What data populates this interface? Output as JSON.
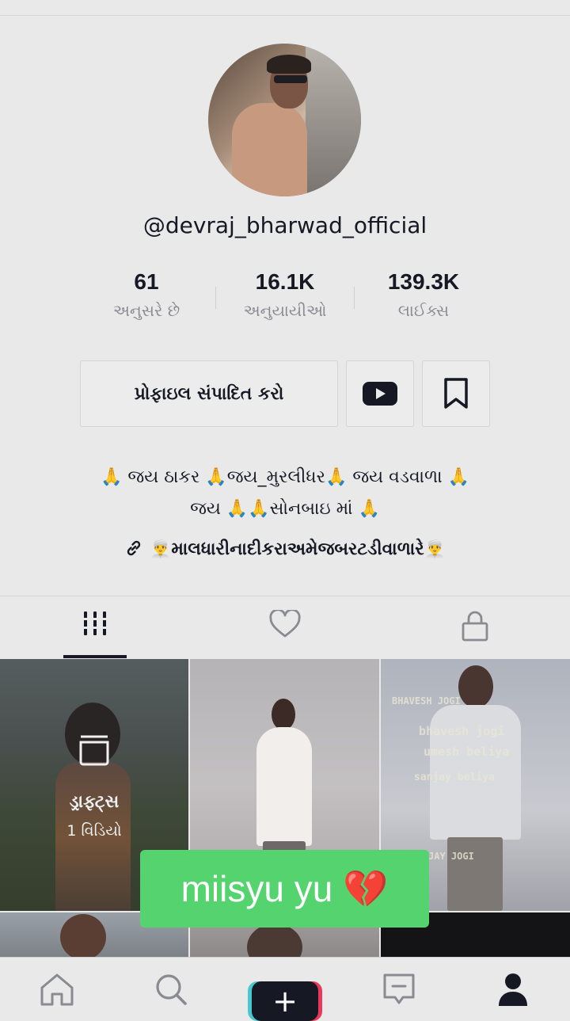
{
  "profile": {
    "username": "@devraj_bharwad_official",
    "stats": [
      {
        "value": "61",
        "label": "અનુસરે છે"
      },
      {
        "value": "16.1K",
        "label": "અનુયાયીઓ"
      },
      {
        "value": "139.3K",
        "label": "લાઈક્સ"
      }
    ],
    "edit_button": "પ્રોફાઇલ સંપાદિત કરો",
    "bio_line1": "🙏 જય ઠાકર 🙏જય_મુરલીધર🙏 જય વડવાળા 🙏",
    "bio_line2": "જય 🙏🙏સોનબાઇ માં 🙏",
    "bio_link": "👳‍♂️માલધારીનાદીકરાઅમેજબરટડીવાળારે👳‍♂️"
  },
  "grid": {
    "drafts_label": "ડ્રાફ્ટ્સ",
    "drafts_count": "1 વિડિયો",
    "overlay_lines": [
      "BHAVESH JOGI",
      "bhavesh jogi",
      "umesh beliya",
      "sanjay beliya",
      "JAY JOGI"
    ]
  },
  "caption": {
    "text": "miisyu yu 💔",
    "color": "#55d36e"
  },
  "colors": {
    "background": "#e9e9ea",
    "text": "#161823",
    "muted": "#8a8b91"
  },
  "icons": [
    "videos-grid-icon",
    "liked-heart-icon",
    "private-lock-icon",
    "youtube-icon",
    "bookmark-icon",
    "link-icon",
    "home-icon",
    "search-icon",
    "create-plus-icon",
    "inbox-icon",
    "profile-icon"
  ]
}
